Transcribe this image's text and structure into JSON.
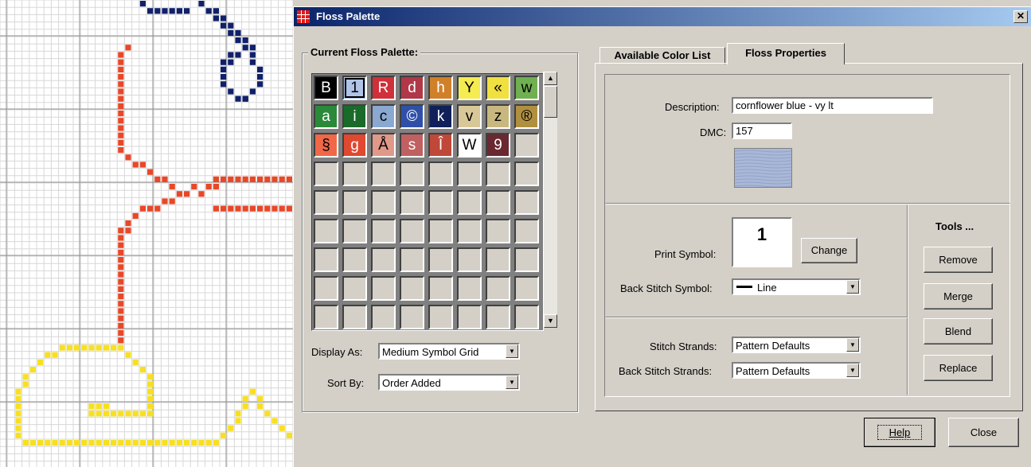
{
  "window": {
    "title": "Floss Palette",
    "close_glyph": "✕"
  },
  "palette": {
    "group_label": "Current Floss Palette:",
    "cells": [
      {
        "sym": "B",
        "bg": "#000000",
        "fg": "#ffffff"
      },
      {
        "sym": "1",
        "bg": "#b0c4e8",
        "fg": "#000000",
        "selected": true
      },
      {
        "sym": "R",
        "bg": "#d0303a",
        "fg": "#ffffff"
      },
      {
        "sym": "d",
        "bg": "#b03848",
        "fg": "#ffffff"
      },
      {
        "sym": "h",
        "bg": "#d08028",
        "fg": "#ffffff"
      },
      {
        "sym": "Y",
        "bg": "#f4ec50",
        "fg": "#000000"
      },
      {
        "sym": "«",
        "bg": "#f0e040",
        "fg": "#000000"
      },
      {
        "sym": "w",
        "bg": "#70b050",
        "fg": "#000000"
      },
      {
        "sym": "a",
        "bg": "#2a8a3a",
        "fg": "#ffffff"
      },
      {
        "sym": "i",
        "bg": "#1a6a2a",
        "fg": "#ffffff"
      },
      {
        "sym": "c",
        "bg": "#8aa8d0",
        "fg": "#000000"
      },
      {
        "sym": "©",
        "bg": "#3050a8",
        "fg": "#ffffff"
      },
      {
        "sym": "k",
        "bg": "#10205a",
        "fg": "#ffffff"
      },
      {
        "sym": "v",
        "bg": "#d8c898",
        "fg": "#000000"
      },
      {
        "sym": "z",
        "bg": "#c8b880",
        "fg": "#000000"
      },
      {
        "sym": "®",
        "bg": "#b09040",
        "fg": "#000000"
      },
      {
        "sym": "§",
        "bg": "#f06848",
        "fg": "#000000"
      },
      {
        "sym": "g",
        "bg": "#e04830",
        "fg": "#ffffff"
      },
      {
        "sym": "Å",
        "bg": "#e09888",
        "fg": "#000000"
      },
      {
        "sym": "s",
        "bg": "#c06060",
        "fg": "#ffffff"
      },
      {
        "sym": "Î",
        "bg": "#c04838",
        "fg": "#ffffff"
      },
      {
        "sym": "W",
        "bg": "#ffffff",
        "fg": "#000000"
      },
      {
        "sym": "9",
        "bg": "#6a2830",
        "fg": "#ffffff"
      }
    ],
    "display_as_label": "Display As:",
    "display_as_value": "Medium Symbol Grid",
    "sort_by_label": "Sort By:",
    "sort_by_value": "Order Added"
  },
  "tabs": [
    {
      "label": "Available Color List",
      "active": false
    },
    {
      "label": "Floss Properties",
      "active": true
    }
  ],
  "properties": {
    "description_label": "Description:",
    "description_value": "cornflower blue - vy lt",
    "dmc_label": "DMC:",
    "dmc_value": "157",
    "swatch_color": "#aab8d8",
    "print_symbol_label": "Print Symbol:",
    "print_symbol_value": "1",
    "change_label": "Change",
    "back_stitch_symbol_label": "Back Stitch Symbol:",
    "back_stitch_symbol_value": "Line",
    "stitch_strands_label": "Stitch Strands:",
    "stitch_strands_value": "Pattern Defaults",
    "back_stitch_strands_label": "Back Stitch Strands:",
    "back_stitch_strands_value": "Pattern Defaults"
  },
  "tools": {
    "heading": "Tools ...",
    "remove": "Remove",
    "merge": "Merge",
    "blend": "Blend",
    "replace": "Replace"
  },
  "footer": {
    "help": "Help",
    "close": "Close"
  },
  "pattern_colors": {
    "navy": "#10206a",
    "red": "#e84828",
    "yellow": "#f8e020"
  }
}
